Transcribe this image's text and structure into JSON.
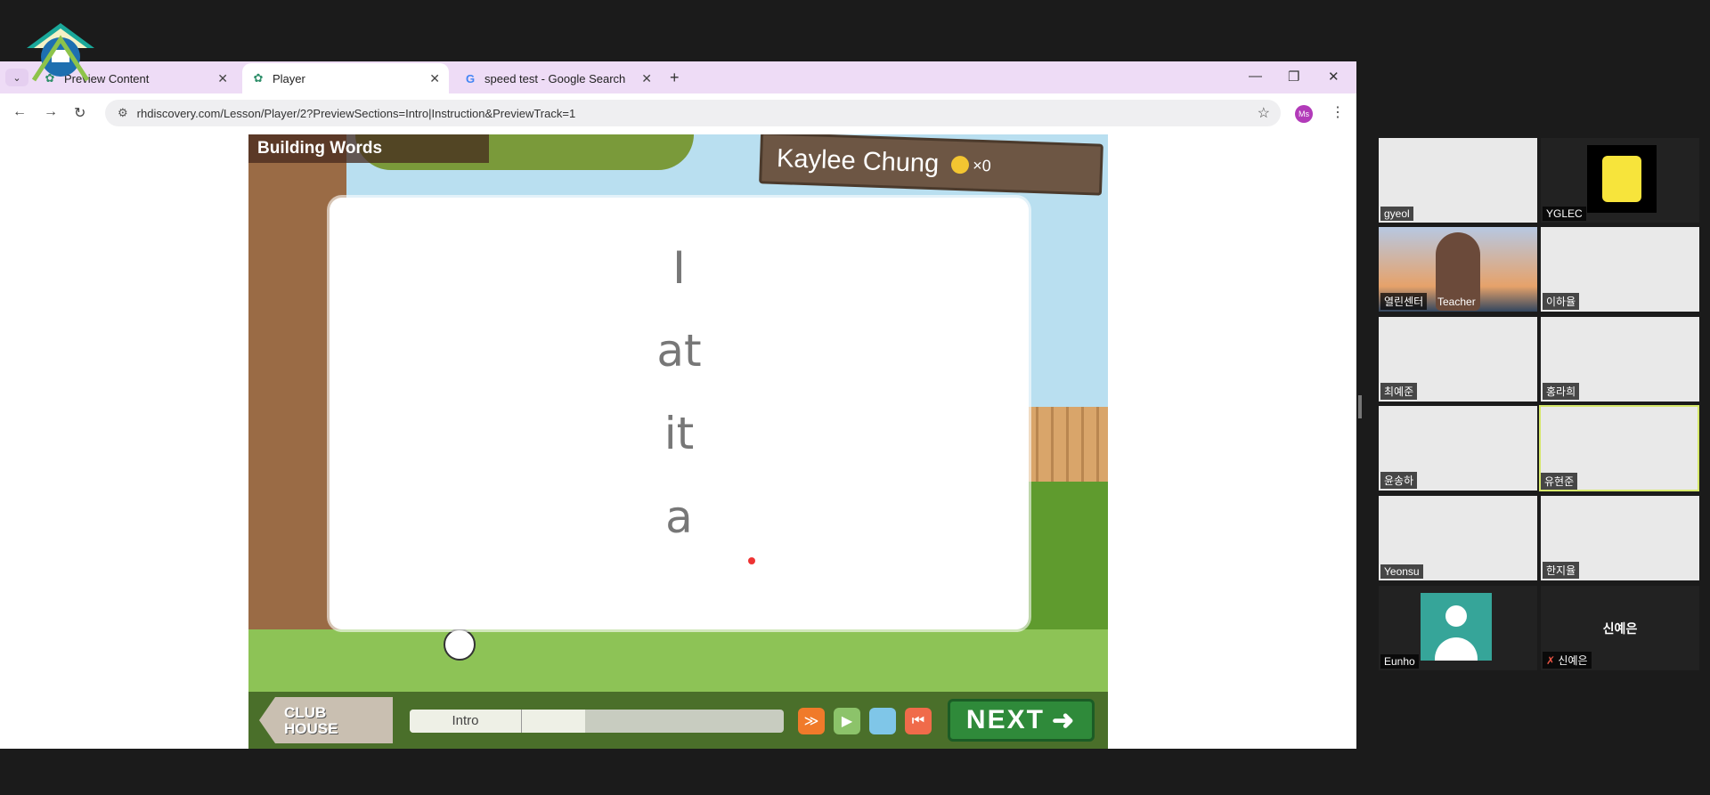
{
  "browser": {
    "tabs": [
      {
        "label": "Preview Content",
        "icon": "butterfly-icon"
      },
      {
        "label": "Player",
        "icon": "butterfly-icon",
        "active": true
      },
      {
        "label": "speed test - Google Search",
        "icon": "google-icon"
      }
    ],
    "url": "rhdiscovery.com/Lesson/Player/2?PreviewSections=Intro|Instruction&PreviewTrack=1",
    "profile_initials": "Ms"
  },
  "game": {
    "title": "Building Words",
    "player_name": "Kaylee Chung",
    "coin_count": "×0",
    "words": [
      "I",
      "at",
      "it",
      "a"
    ],
    "club_house_line1": "CLUB",
    "club_house_line2": "HOUSE",
    "progress_label": "Intro",
    "progress_fraction": 0.47,
    "next_label": "NEXT"
  },
  "participants": [
    {
      "name": "gyeol"
    },
    {
      "name": "YGLEC"
    },
    {
      "name": "열린센터",
      "role": "Teacher"
    },
    {
      "name": "이하율"
    },
    {
      "name": "최예준"
    },
    {
      "name": "홍라희"
    },
    {
      "name": "윤송하"
    },
    {
      "name": "유현준",
      "active_speaker": true
    },
    {
      "name": "Yeonsu"
    },
    {
      "name": "한지율"
    },
    {
      "name": "Eunho"
    },
    {
      "name": "신예은",
      "muted": true,
      "camera_off_label": "신예은"
    }
  ],
  "colors": {
    "tabbar": "#eedcf6",
    "next_button": "#2f8a3a",
    "avatar_tile": "#36a599",
    "active_speaker_border": "#d6e86a"
  }
}
